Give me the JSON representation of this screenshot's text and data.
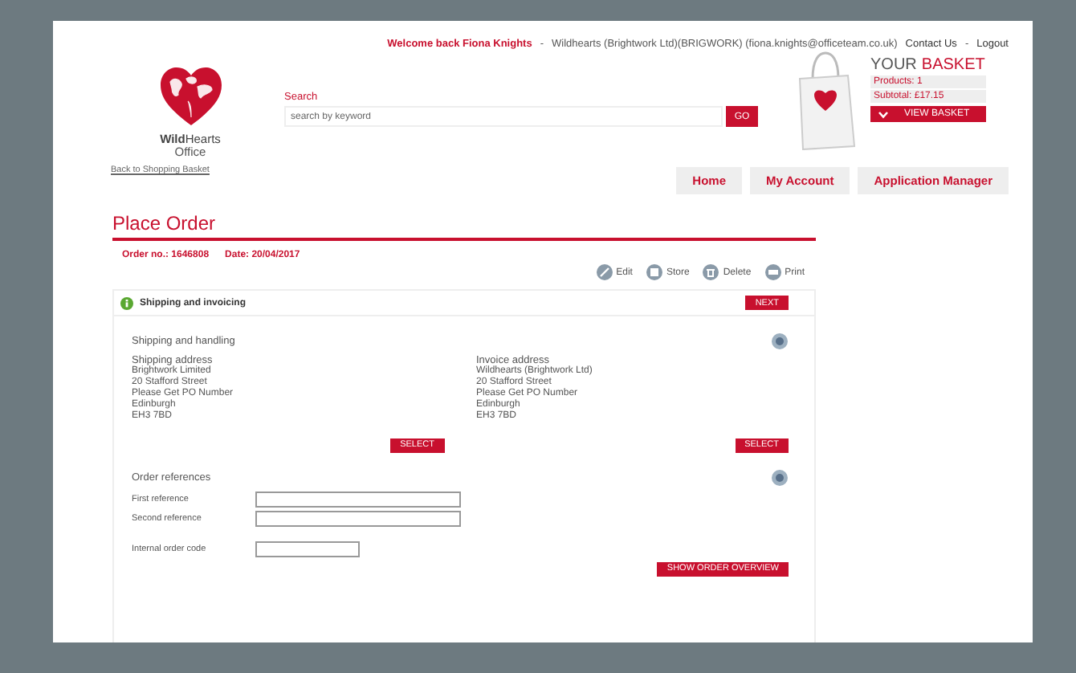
{
  "top_bar": {
    "welcome": "Welcome back  Fiona Knights",
    "separators": [
      "-",
      "-"
    ],
    "account": "Wildhearts (Brightwork Ltd)(BRIGWORK)  (fiona.knights@officeteam.co.uk)",
    "contact": "Contact Us",
    "logout": "Logout"
  },
  "logo": {
    "name": "**Wild**Hearts",
    "subtitle": "Office"
  },
  "back_link": "Back to Shopping Basket",
  "search": {
    "label": "Search",
    "placeholder": "search by keyword",
    "button": "GO"
  },
  "basket": {
    "title_lead": "YOUR",
    "title_accent": "BASKET",
    "rows": [
      "Products: 1",
      "Subtotal: £17.15"
    ],
    "button": "VIEW BASKET"
  },
  "nav": [
    "Home",
    "My Account",
    "Application Manager"
  ],
  "order": {
    "title": "Place Order",
    "order_no": "Order no.: 1646808",
    "date": "Date: 20/04/2017"
  },
  "actions": [
    {
      "label": "Edit",
      "kind": "edit"
    },
    {
      "label": "Store",
      "kind": "store"
    },
    {
      "label": "Delete",
      "kind": "delete"
    },
    {
      "label": "Print",
      "kind": "print"
    }
  ],
  "panel": {
    "title": "Shipping and invoicing",
    "next": "NEXT",
    "shipping": {
      "title": "Shipping and handling",
      "addresses": [
        {
          "heading": "Shipping address",
          "lines": [
            "Brightwork Limited",
            "20 Stafford Street",
            "Please Get PO Number",
            "Edinburgh",
            "EH3 7BD"
          ],
          "button": "SELECT"
        },
        {
          "heading": "Invoice address",
          "lines": [
            "Wildhearts (Brightwork Ltd)",
            "20 Stafford Street",
            "Please Get PO Number",
            "Edinburgh",
            "EH3 7BD"
          ],
          "button": "SELECT"
        }
      ]
    },
    "references": {
      "title": "Order references",
      "fields": [
        {
          "label": "First reference",
          "kind": "wide"
        },
        {
          "label": "Second reference",
          "kind": "wide"
        },
        {
          "label": "Internal order code",
          "kind": "short"
        }
      ],
      "button": "SHOW ORDER OVERVIEW"
    }
  }
}
